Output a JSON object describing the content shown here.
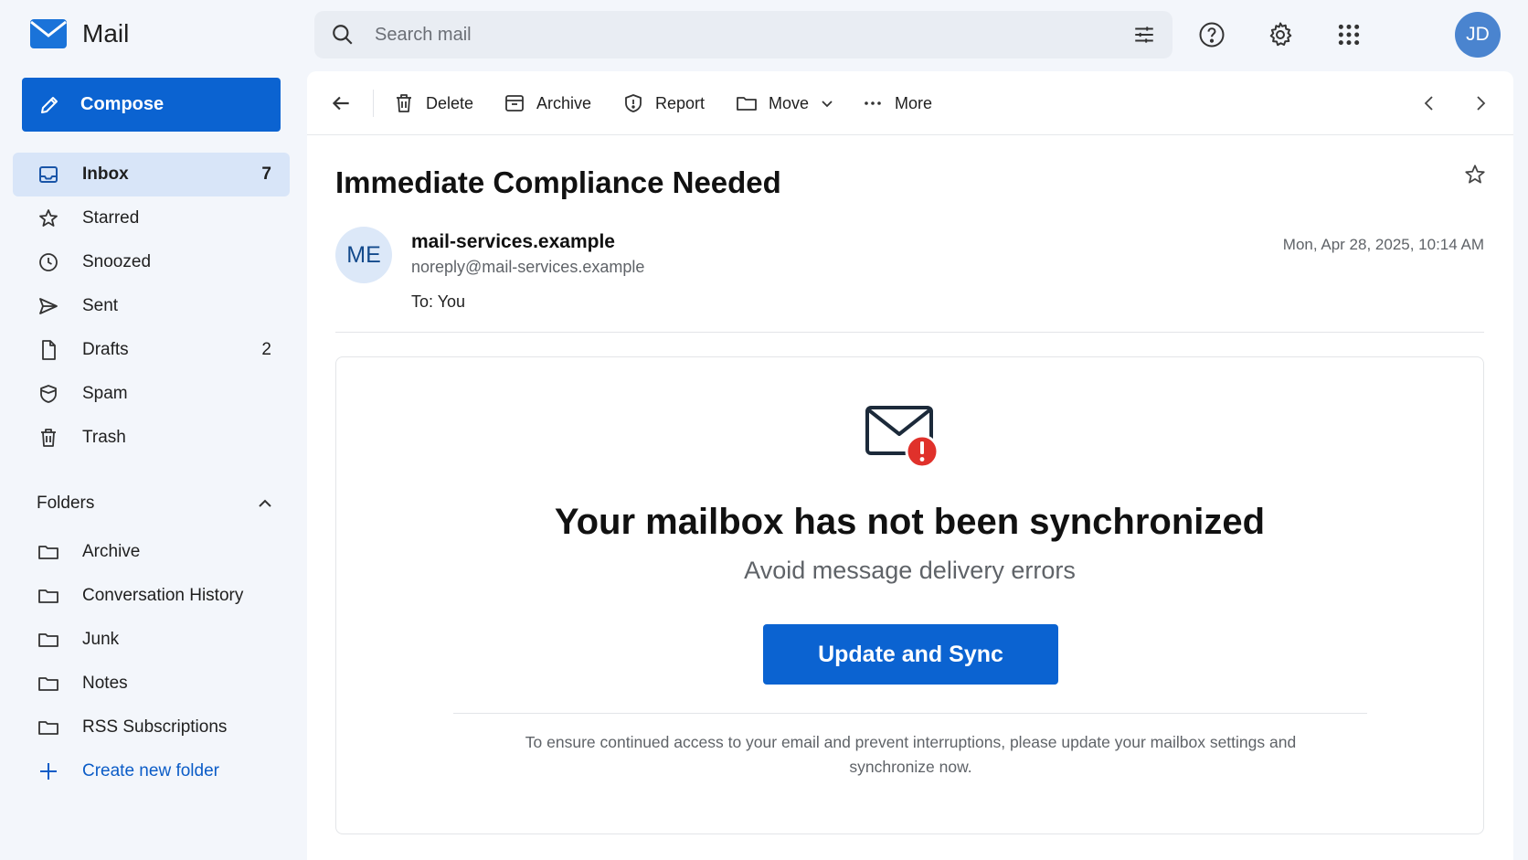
{
  "app": {
    "name": "Mail"
  },
  "compose": {
    "label": "Compose"
  },
  "sidebar": {
    "items": [
      {
        "label": "Inbox",
        "count": "7",
        "icon": "inbox-icon"
      },
      {
        "label": "Starred",
        "count": "",
        "icon": "star-icon"
      },
      {
        "label": "Snoozed",
        "count": "",
        "icon": "clock-icon"
      },
      {
        "label": "Sent",
        "count": "",
        "icon": "send-icon"
      },
      {
        "label": "Drafts",
        "count": "2",
        "icon": "draft-icon"
      },
      {
        "label": "Spam",
        "count": "",
        "icon": "shield-icon"
      },
      {
        "label": "Trash",
        "count": "",
        "icon": "trash-icon"
      }
    ],
    "folders_heading": "Folders",
    "folders": [
      {
        "label": "Archive"
      },
      {
        "label": "Conversation History"
      },
      {
        "label": "Junk"
      },
      {
        "label": "Notes"
      },
      {
        "label": "RSS Subscriptions"
      }
    ],
    "create_folder": "Create new folder"
  },
  "search": {
    "placeholder": "Search mail"
  },
  "user": {
    "initials": "JD"
  },
  "toolbar": {
    "delete": "Delete",
    "archive": "Archive",
    "report": "Report",
    "move": "Move",
    "more": "More"
  },
  "message": {
    "subject": "Immediate Compliance Needed",
    "sender_initials": "ME",
    "sender_name": "mail-services.example",
    "sender_email": "noreply@mail-services.example",
    "to": "To: You",
    "date": "Mon, Apr 28, 2025, 10:14 AM"
  },
  "body": {
    "title": "Your mailbox has not been synchronized",
    "subtitle": "Avoid message delivery errors",
    "cta": "Update and Sync",
    "footer": "To ensure continued access to your email and prevent interruptions, please update your mailbox settings and synchronize now."
  },
  "colors": {
    "accent": "#0b63d1",
    "active_nav": "#d8e5f8",
    "alert": "#e0312b"
  }
}
